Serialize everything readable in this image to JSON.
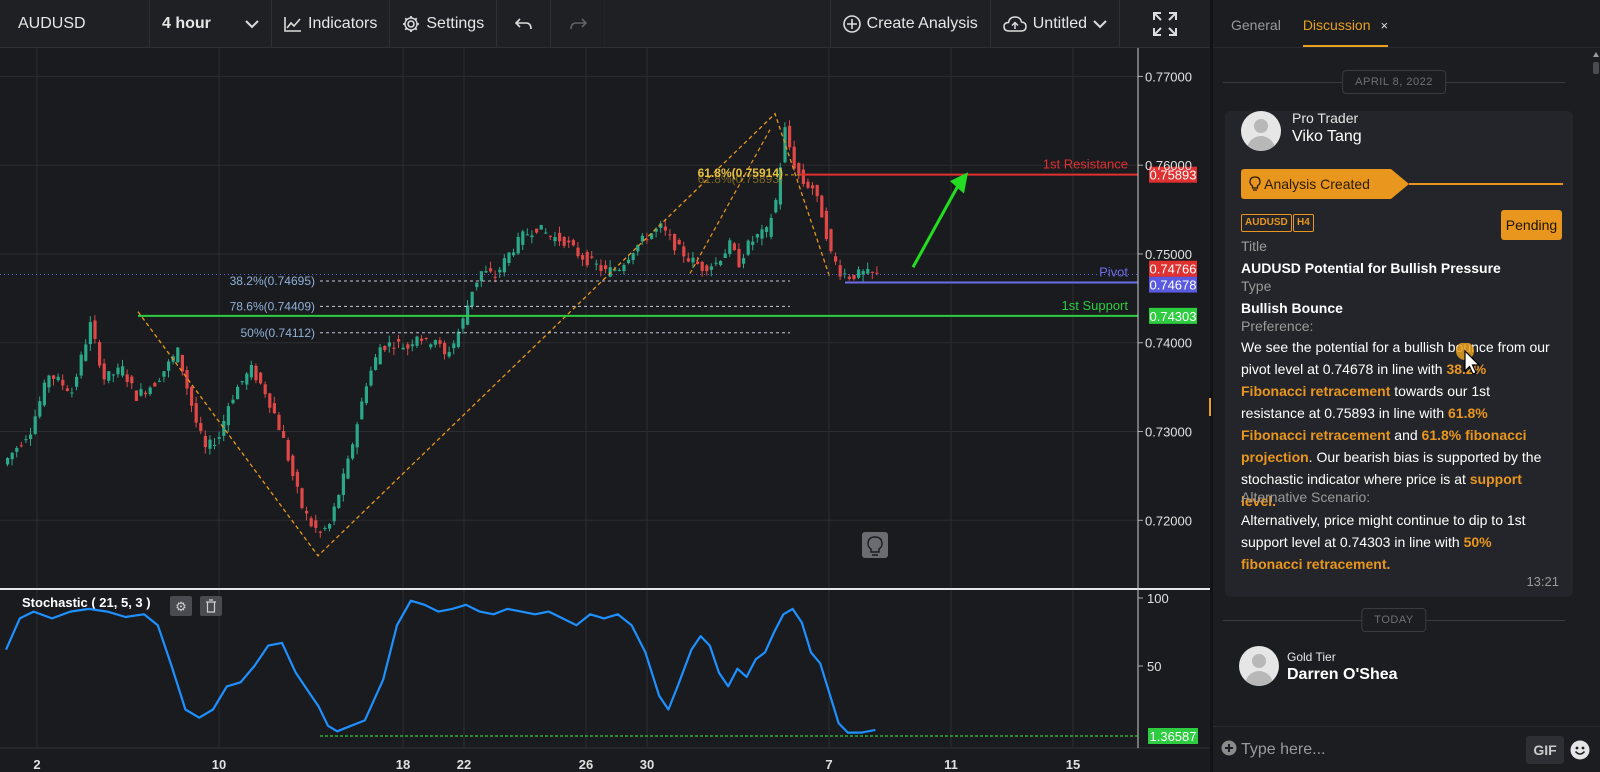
{
  "toolbar": {
    "symbol": "AUDUSD",
    "timeframe": "4 hour",
    "indicators_label": "Indicators",
    "settings_label": "Settings",
    "create_analysis_label": "Create Analysis",
    "layout_name": "Untitled",
    "icons": [
      "chevron-down-icon",
      "chart-line-icon",
      "gear-icon",
      "undo-icon",
      "redo-icon",
      "plus-circle-icon",
      "cloud-upload-icon",
      "fullscreen-icon"
    ]
  },
  "chart_data": [
    {
      "type": "candlestick",
      "symbol": "AUDUSD",
      "y_ticks": [
        "0.77000",
        "0.76000",
        "0.75000",
        "0.74000",
        "0.73000",
        "0.72000"
      ],
      "ylim": [
        0.7126,
        0.7732
      ],
      "x_ticks": [
        "2",
        "10",
        "18",
        "22",
        "26",
        "30",
        "7",
        "11",
        "15"
      ],
      "price_path": [
        [
          0,
          0.7263
        ],
        [
          6,
          0.7302
        ],
        [
          10,
          0.7365
        ],
        [
          15,
          0.7345
        ],
        [
          19,
          0.742
        ],
        [
          22,
          0.736
        ],
        [
          26,
          0.737
        ],
        [
          29,
          0.734
        ],
        [
          33,
          0.7355
        ],
        [
          38,
          0.739
        ],
        [
          42,
          0.731
        ],
        [
          44,
          0.728
        ],
        [
          47,
          0.7295
        ],
        [
          49,
          0.733
        ],
        [
          51,
          0.735
        ],
        [
          54,
          0.737
        ],
        [
          57,
          0.7345
        ],
        [
          59,
          0.732
        ],
        [
          61,
          0.729
        ],
        [
          63,
          0.725
        ],
        [
          65,
          0.7215
        ],
        [
          67,
          0.7195
        ],
        [
          69,
          0.7185
        ],
        [
          71,
          0.7195
        ],
        [
          73,
          0.723
        ],
        [
          75,
          0.7265
        ],
        [
          77,
          0.731
        ],
        [
          79,
          0.7355
        ],
        [
          82,
          0.7395
        ],
        [
          85,
          0.74
        ],
        [
          88,
          0.7395
        ],
        [
          90,
          0.741
        ],
        [
          92,
          0.74
        ],
        [
          94,
          0.7405
        ],
        [
          96,
          0.7385
        ],
        [
          98,
          0.74
        ],
        [
          100,
          0.7425
        ],
        [
          102,
          0.746
        ],
        [
          104,
          0.748
        ],
        [
          107,
          0.7475
        ],
        [
          110,
          0.75
        ],
        [
          113,
          0.752
        ],
        [
          116,
          0.753
        ],
        [
          119,
          0.752
        ],
        [
          122,
          0.7515
        ],
        [
          125,
          0.75
        ],
        [
          128,
          0.749
        ],
        [
          131,
          0.748
        ],
        [
          134,
          0.7485
        ],
        [
          137,
          0.7505
        ],
        [
          140,
          0.752
        ],
        [
          143,
          0.753
        ],
        [
          146,
          0.751
        ],
        [
          149,
          0.7495
        ],
        [
          152,
          0.7485
        ],
        [
          155,
          0.749
        ],
        [
          158,
          0.751
        ],
        [
          160,
          0.749
        ],
        [
          162,
          0.751
        ],
        [
          164,
          0.752
        ],
        [
          166,
          0.7525
        ],
        [
          168,
          0.756
        ],
        [
          170,
          0.764
        ],
        [
          172,
          0.76
        ],
        [
          174,
          0.758
        ],
        [
          176,
          0.7575
        ],
        [
          178,
          0.7545
        ],
        [
          180,
          0.75
        ],
        [
          182,
          0.748
        ],
        [
          184,
          0.7475
        ],
        [
          187,
          0.7478
        ],
        [
          190,
          0.7476
        ]
      ],
      "overlays": {
        "pivot": {
          "label": "Pivot",
          "value": "0.74678",
          "y": 0.74678,
          "color": "#6a6ce8"
        },
        "resistance": {
          "label": "1st Resistance",
          "value": "0.75893",
          "y": 0.75893,
          "color": "#e03030"
        },
        "support": {
          "label": "1st Support",
          "value": "0.74303",
          "y": 0.74303,
          "color": "#2ecc40"
        },
        "last_price": {
          "value": "0.74766",
          "y": 0.74766,
          "color": "#e03030"
        },
        "fib_retracements": [
          {
            "label": "38.2%(0.74695)",
            "y": 0.74695
          },
          {
            "label": "78.6%(0.74409)",
            "y": 0.74409
          },
          {
            "label": "50%(0.74112)",
            "y": 0.74112
          }
        ],
        "fib_extension": {
          "label": "61.8%(0.75914)",
          "label_overlap": "61.8%(0.75893)",
          "y": 0.75914
        }
      }
    },
    {
      "type": "line",
      "title": "Stochastic ( 21, 5, 3 )",
      "y_ticks": [
        "100",
        "50"
      ],
      "ylim": [
        0,
        100
      ],
      "last_value": "1.36587",
      "values": [
        [
          0,
          62
        ],
        [
          3,
          85
        ],
        [
          6,
          90
        ],
        [
          10,
          85
        ],
        [
          14,
          90
        ],
        [
          18,
          92
        ],
        [
          22,
          90
        ],
        [
          26,
          86
        ],
        [
          30,
          88
        ],
        [
          33,
          80
        ],
        [
          36,
          50
        ],
        [
          39,
          18
        ],
        [
          42,
          12
        ],
        [
          45,
          18
        ],
        [
          48,
          35
        ],
        [
          51,
          38
        ],
        [
          54,
          50
        ],
        [
          57,
          65
        ],
        [
          60,
          67
        ],
        [
          63,
          45
        ],
        [
          66,
          30
        ],
        [
          68,
          20
        ],
        [
          70,
          6
        ],
        [
          72,
          2
        ],
        [
          75,
          6
        ],
        [
          78,
          10
        ],
        [
          82,
          40
        ],
        [
          85,
          80
        ],
        [
          88,
          98
        ],
        [
          91,
          95
        ],
        [
          94,
          90
        ],
        [
          97,
          92
        ],
        [
          100,
          95
        ],
        [
          103,
          90
        ],
        [
          106,
          88
        ],
        [
          109,
          92
        ],
        [
          112,
          90
        ],
        [
          115,
          88
        ],
        [
          118,
          90
        ],
        [
          121,
          85
        ],
        [
          124,
          80
        ],
        [
          127,
          88
        ],
        [
          130,
          85
        ],
        [
          133,
          88
        ],
        [
          136,
          80
        ],
        [
          139,
          60
        ],
        [
          142,
          28
        ],
        [
          144,
          18
        ],
        [
          146,
          35
        ],
        [
          149,
          62
        ],
        [
          151,
          72
        ],
        [
          153,
          65
        ],
        [
          155,
          45
        ],
        [
          157,
          35
        ],
        [
          159,
          48
        ],
        [
          161,
          42
        ],
        [
          163,
          55
        ],
        [
          165,
          60
        ],
        [
          167,
          75
        ],
        [
          169,
          88
        ],
        [
          171,
          92
        ],
        [
          173,
          82
        ],
        [
          175,
          60
        ],
        [
          177,
          52
        ],
        [
          179,
          30
        ],
        [
          181,
          8
        ],
        [
          183,
          1
        ],
        [
          186,
          1
        ],
        [
          189,
          3
        ]
      ]
    }
  ],
  "panel": {
    "tabs": [
      "General",
      "Discussion"
    ],
    "tab_close": "×",
    "date_separator_1": "APRIL 8, 2022",
    "date_separator_2": "TODAY",
    "post": {
      "role": "Pro Trader",
      "author": "Viko Tang",
      "banner": "Analysis Created",
      "badges": [
        "AUDUSD",
        "H4"
      ],
      "status": "Pending",
      "title_label": "Title",
      "title": "AUDUSD Potential for Bullish Pressure",
      "type_label": "Type",
      "type": "Bullish Bounce",
      "preference_label": "Preference:",
      "preference": [
        {
          "t": "We see the potential for a bullish bounce from our pivot level at 0.74678 in line with ",
          "h": false
        },
        {
          "t": "38.2% Fibonacci retracement",
          "h": true
        },
        {
          "t": " towards our 1st resistance at 0.75893 in line with ",
          "h": false
        },
        {
          "t": "61.8% Fibonacci retracement",
          "h": true
        },
        {
          "t": " and ",
          "h": false
        },
        {
          "t": "61.8% fibonacci projection",
          "h": true
        },
        {
          "t": ". Our bearish bias is supported by the stochastic indicator where price is at ",
          "h": false
        },
        {
          "t": "support level.",
          "h": true
        }
      ],
      "alt_label": "Alternative Scenario:",
      "alternative": [
        {
          "t": "Alternatively, price might continue to dip to 1st support level at 0.74303 in line with ",
          "h": false
        },
        {
          "t": "50% fibonacci retracement.",
          "h": true
        }
      ],
      "time": "13:21"
    },
    "post2": {
      "role": "Gold Tier",
      "author": "Darren O'Shea"
    },
    "message": {
      "placeholder": "Type here...",
      "gif_label": "GIF"
    }
  },
  "colors": {
    "accent": "#e8961e",
    "bull": "#2aa98a",
    "bear": "#e04848",
    "stoch": "#1e90ff"
  }
}
